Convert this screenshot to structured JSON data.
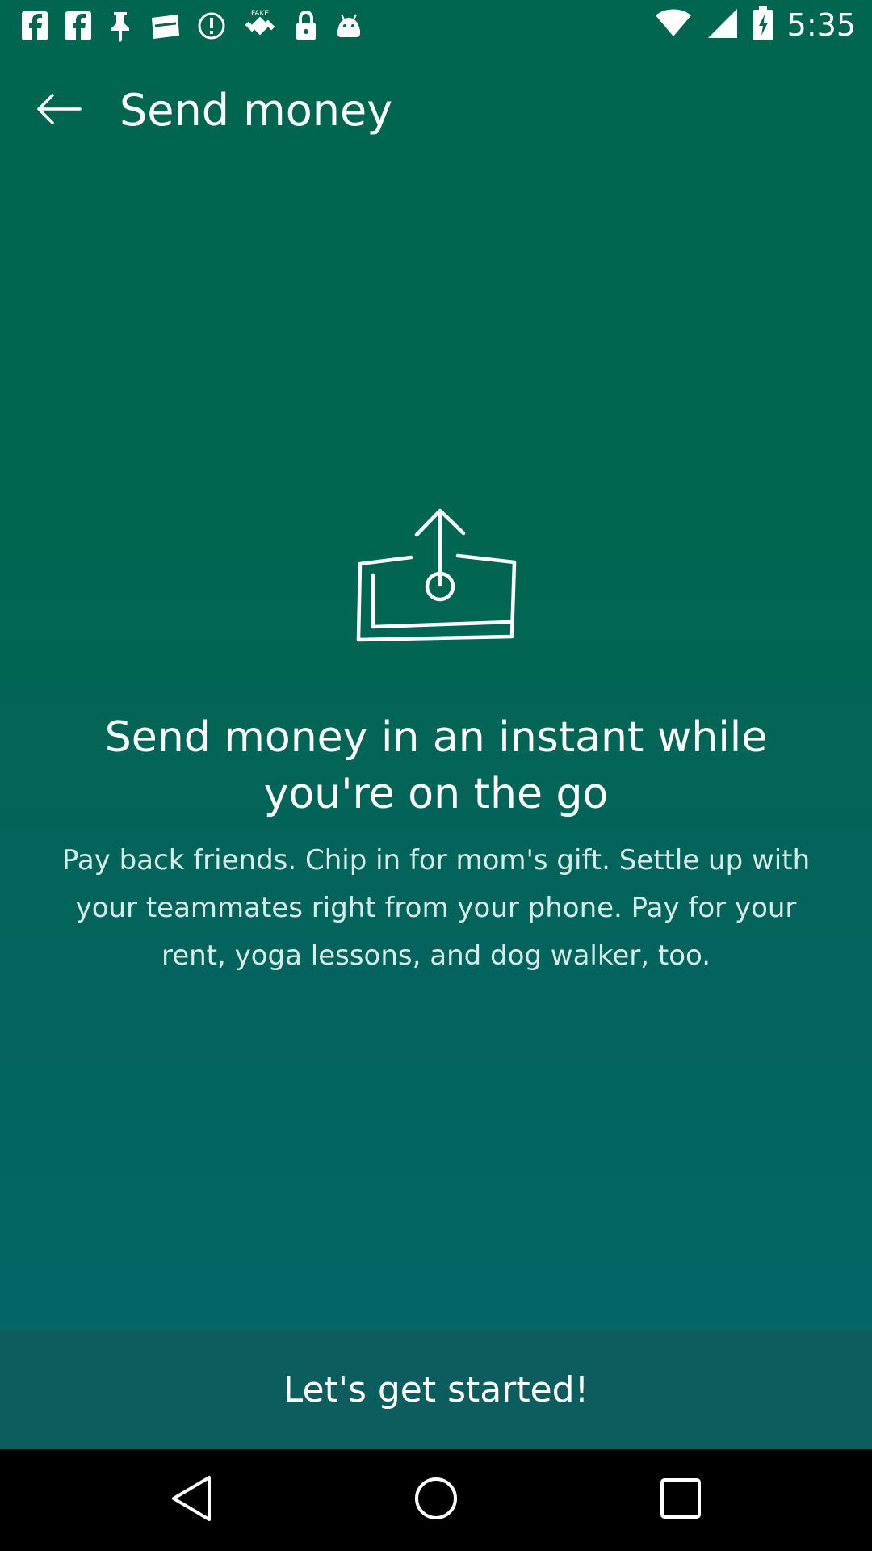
{
  "status_bar": {
    "time": "5:35",
    "left_icons": [
      "facebook-icon",
      "facebook-icon",
      "pin-icon",
      "inbox-icon",
      "alert-circle-icon",
      "fake-gps-icon",
      "lock-icon",
      "android-icon"
    ],
    "right_icons": [
      "wifi-icon",
      "signal-icon",
      "battery-icon"
    ]
  },
  "app_bar": {
    "title": "Send money",
    "back_icon": "arrow-left-icon"
  },
  "hero": {
    "illustration_icon": "send-money-icon",
    "headline": "Send money in an instant while you're on the go",
    "description": "Pay back friends. Chip in for mom's gift. Settle up with your teammates right from your phone. Pay for your rent, yoga lessons, and dog walker, too."
  },
  "cta": {
    "label": "Let's get started!"
  },
  "nav_bar": {
    "icons": [
      "back-triangle-icon",
      "home-circle-icon",
      "recents-square-icon"
    ]
  },
  "colors": {
    "background_top": "#006650",
    "background_bottom": "#036767",
    "cta_background": "#0b5e5d",
    "text_primary": "#ffffff",
    "nav_background": "#000000"
  }
}
